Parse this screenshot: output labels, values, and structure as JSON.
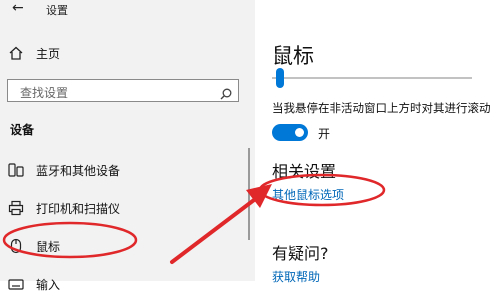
{
  "window": {
    "back_glyph": "←",
    "title": "设置"
  },
  "sidebar": {
    "home_label": "主页",
    "search": {
      "placeholder": "查找设置"
    },
    "section_heading": "设备",
    "items": [
      {
        "label": "蓝牙和其他设备",
        "icon": "devices-icon"
      },
      {
        "label": "打印机和扫描仪",
        "icon": "printer-icon"
      },
      {
        "label": "鼠标",
        "icon": "mouse-icon"
      },
      {
        "label": "输入",
        "icon": "keyboard-icon"
      }
    ]
  },
  "main": {
    "title": "鼠标",
    "slider": {
      "value_fraction": 0.03
    },
    "scroll_inactive_label": "当我悬停在非活动窗口上方时对其进行滚动",
    "toggle": {
      "state_label": "开",
      "on": true
    },
    "related_heading": "相关设置",
    "other_mouse_options": "其他鼠标选项",
    "question_heading": "有疑问?",
    "get_help": "获取帮助"
  },
  "colors": {
    "accent": "#0078d7",
    "link": "#0067b8",
    "annotation": "#e0272a",
    "sidebar_bg": "#f2f2f2"
  }
}
